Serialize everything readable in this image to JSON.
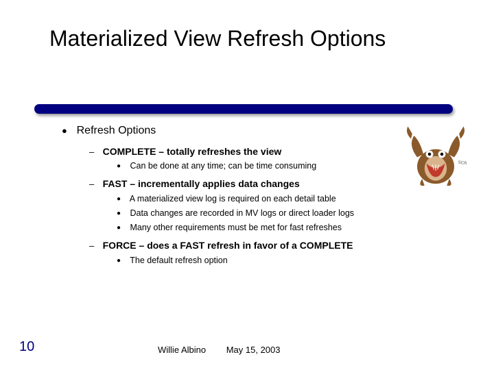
{
  "title": "Materialized View Refresh Options",
  "heading": "Refresh Options",
  "options": [
    {
      "label": "COMPLETE – totally refreshes the view",
      "points": [
        "Can be done at any time; can be time consuming"
      ]
    },
    {
      "label": "FAST – incrementally applies data changes",
      "points": [
        "A materialized view log is required on each detail table",
        "Data changes are recorded in MV logs or direct loader logs",
        "Many other requirements must be met for fast refreshes"
      ]
    },
    {
      "label": "FORCE – does a FAST refresh in favor of a COMPLETE",
      "points": [
        "The default refresh option"
      ]
    }
  ],
  "footer": {
    "author": "Willie Albino",
    "date": "May 15, 2003"
  },
  "slide_number": "10"
}
